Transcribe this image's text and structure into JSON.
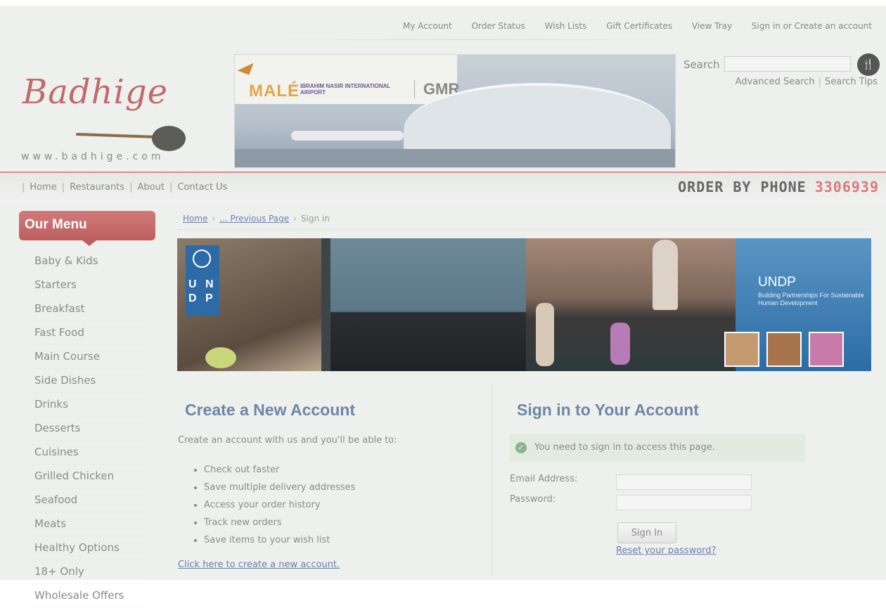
{
  "top_nav": [
    "My Account",
    "Order Status",
    "Wish Lists",
    "Gift Certificates",
    "View Tray",
    "Sign in or Create an account"
  ],
  "logo": {
    "word": "Badhige",
    "url": "www.badhige.com"
  },
  "airport_banner": {
    "name": "MALÉ",
    "subtitle": "IBRAHIM NASIR INTERNATIONAL AIRPORT",
    "brand": "GMR"
  },
  "search": {
    "label": "Search",
    "value": "",
    "icon": "fork-knife-icon",
    "advanced": "Advanced Search",
    "tips": "Search Tips"
  },
  "main_nav": {
    "items": [
      "Home",
      "Restaurants",
      "About",
      "Contact Us"
    ]
  },
  "order": {
    "text": "ORDER BY PHONE",
    "phone": "3306939"
  },
  "sidebar": {
    "title": "Our Menu",
    "items": [
      "Baby & Kids",
      "Starters",
      "Breakfast",
      "Fast Food",
      "Main Course",
      "Side Dishes",
      "Drinks",
      "Desserts",
      "Cuisines",
      "Grilled Chicken",
      "Seafood",
      "Meats",
      "Healthy Options",
      "18+ Only",
      "Wholesale Offers"
    ]
  },
  "breadcrumb": {
    "home": "Home",
    "previous": "... Previous Page",
    "current": "Sign in"
  },
  "undp_banner": {
    "title": "UNDP",
    "tagline": "Building Partnerships For Sustainable Human Development",
    "logo_text": [
      "U N",
      "D P"
    ]
  },
  "create": {
    "title": "Create a New Account",
    "intro": "Create an account with us and you'll be able to:",
    "benefits": [
      "Check out faster",
      "Save multiple delivery addresses",
      "Access your order history",
      "Track new orders",
      "Save items to your wish list"
    ],
    "link": "Click here to create a new account."
  },
  "signin": {
    "title": "Sign in to Your Account",
    "notice": "You need to sign in to access this page.",
    "email_label": "Email Address:",
    "email_value": "",
    "password_label": "Password:",
    "password_value": "",
    "button": "Sign In",
    "reset_link": "Reset your password?"
  },
  "colors": {
    "accent": "#c86b6b",
    "link": "#6a7fa8",
    "heading": "#6e86a6",
    "notice_bg": "#e3ebe1"
  }
}
